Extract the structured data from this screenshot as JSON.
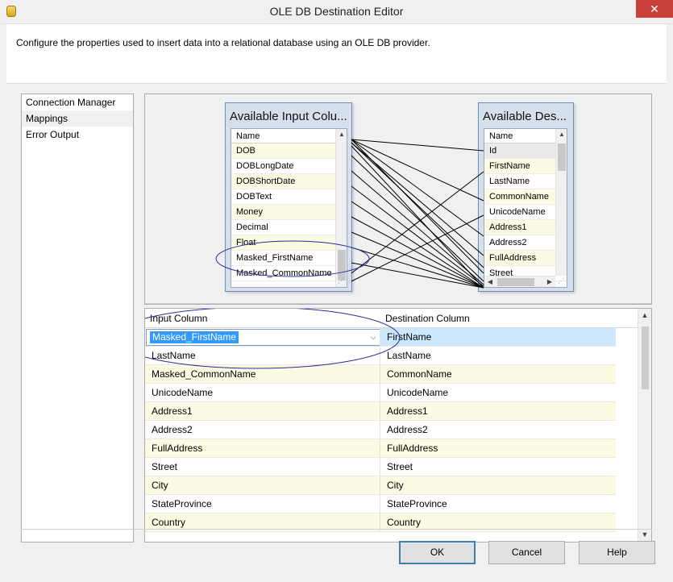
{
  "window": {
    "title": "OLE DB Destination Editor",
    "close_glyph": "✕"
  },
  "header": {
    "description": "Configure the properties used to insert data into a relational database using an OLE DB provider."
  },
  "nav": {
    "items": [
      {
        "label": "Connection Manager"
      },
      {
        "label": "Mappings"
      },
      {
        "label": "Error Output"
      }
    ]
  },
  "input_box": {
    "title": "Available Input Colu...",
    "header": "Name",
    "rows": [
      "DOB",
      "DOBLongDate",
      "DOBShortDate",
      "DOBText",
      "Money",
      "Decimal",
      "Float",
      "Masked_FirstName",
      "Masked_CommonName"
    ]
  },
  "dest_box": {
    "title": "Available Des...",
    "header": "Name",
    "rows": [
      "Id",
      "FirstName",
      "LastName",
      "CommonName",
      "UnicodeName",
      "Address1",
      "Address2",
      "FullAddress",
      "Street"
    ]
  },
  "grid": {
    "headers": {
      "input": "Input Column",
      "dest": "Destination Column"
    },
    "rows": [
      {
        "input": "Masked_FirstName",
        "dest": "FirstName"
      },
      {
        "input": "LastName",
        "dest": "LastName"
      },
      {
        "input": "Masked_CommonName",
        "dest": "CommonName"
      },
      {
        "input": "UnicodeName",
        "dest": "UnicodeName"
      },
      {
        "input": "Address1",
        "dest": "Address1"
      },
      {
        "input": "Address2",
        "dest": "Address2"
      },
      {
        "input": "FullAddress",
        "dest": "FullAddress"
      },
      {
        "input": "Street",
        "dest": "Street"
      },
      {
        "input": "City",
        "dest": "City"
      },
      {
        "input": "StateProvince",
        "dest": "StateProvince"
      },
      {
        "input": "Country",
        "dest": "Country"
      }
    ]
  },
  "buttons": {
    "ok": "OK",
    "cancel": "Cancel",
    "help": "Help"
  },
  "colors": {
    "alt_row": "#fbfbe4",
    "selection": "#3399ff",
    "annotation_ellipse": "#2b2b9c",
    "close_button": "#c7403a"
  }
}
